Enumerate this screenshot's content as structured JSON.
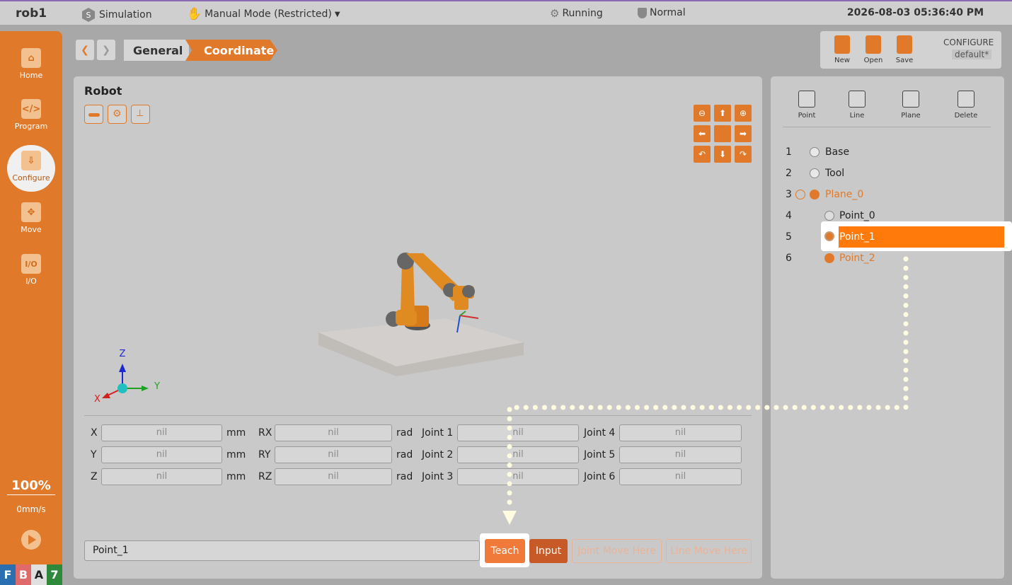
{
  "topbar": {
    "robot_name": "rob1",
    "mode": "Simulation",
    "manual_mode": "Manual Mode (Restricted)",
    "run_state": "Running",
    "safety": "Normal",
    "datetime": "2026-08-03 05:36:40 PM"
  },
  "sidebar": {
    "items": [
      {
        "label": "Home"
      },
      {
        "label": "Program"
      },
      {
        "label": "Configure"
      },
      {
        "label": "Move"
      },
      {
        "label": "I/O"
      }
    ],
    "speed_percent": "100%",
    "speed_value": "0mm/s",
    "status_letters": [
      "F",
      "B",
      "A",
      "7"
    ]
  },
  "breadcrumb": {
    "items": [
      "General",
      "Coordinate"
    ]
  },
  "config_toolbar": {
    "new_label": "New",
    "open_label": "Open",
    "save_label": "Save",
    "configure_label": "CONFIGURE",
    "config_name": "default*"
  },
  "robot_panel": {
    "title": "Robot",
    "axes": {
      "x": "X",
      "y": "Y",
      "z": "Z"
    },
    "fields": {
      "X": "nil",
      "Y": "nil",
      "Z": "nil",
      "RX": "nil",
      "RY": "nil",
      "RZ": "nil",
      "Joint 1": "nil",
      "Joint 2": "nil",
      "Joint 3": "nil",
      "Joint 4": "nil",
      "Joint 5": "nil",
      "Joint 6": "nil"
    },
    "units": {
      "linear": "mm",
      "angular": "rad"
    },
    "labels": {
      "x": "X",
      "y": "Y",
      "z": "Z",
      "rx": "RX",
      "ry": "RY",
      "rz": "RZ",
      "j1": "Joint 1",
      "j2": "Joint 2",
      "j3": "Joint 3",
      "j4": "Joint 4",
      "j5": "Joint 5",
      "j6": "Joint 6"
    },
    "name_value": "Point_1",
    "buttons": {
      "teach": "Teach",
      "input": "Input",
      "joint_move": "Joint Move Here",
      "line_move": "Line Move Here"
    }
  },
  "right_panel": {
    "tools": [
      "Point",
      "Line",
      "Plane",
      "Delete"
    ],
    "tree": [
      {
        "num": "1",
        "label": "Base"
      },
      {
        "num": "2",
        "label": "Tool"
      },
      {
        "num": "3",
        "label": "Plane_0"
      },
      {
        "num": "4",
        "label": "Point_0"
      },
      {
        "num": "5",
        "label": "Point_1"
      },
      {
        "num": "6",
        "label": "Point_2"
      }
    ]
  },
  "colors": {
    "accent": "#e07a2a",
    "selected": "#ff7a0a",
    "teach": "#f07a3a",
    "input": "#c85a28"
  }
}
